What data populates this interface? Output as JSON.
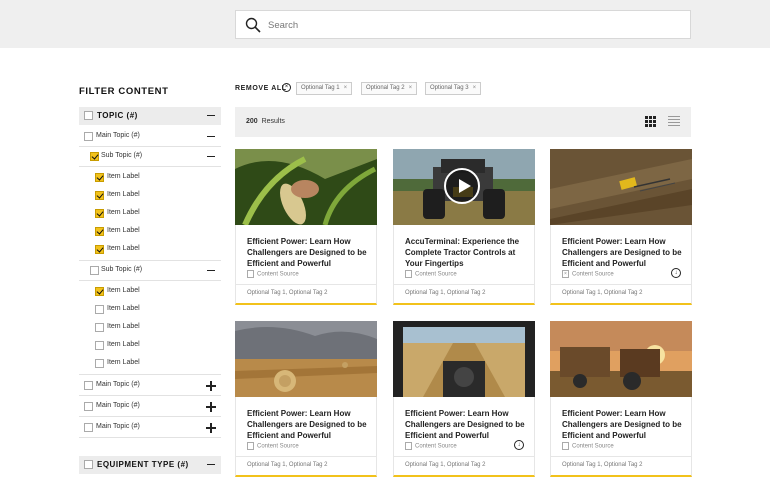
{
  "search": {
    "placeholder": "Search"
  },
  "sidebar": {
    "title": "FILTER CONTENT",
    "topic_section": {
      "label": "TOPIC (#)"
    },
    "main_topic_1": "Main Topic (#)",
    "sub_topic_1": "Sub Topic (#)",
    "sub_topic_1_items": [
      "Item Label",
      "Item Label",
      "Item Label",
      "Item Label",
      "Item Label"
    ],
    "sub_topic_2": "Sub Topic (#)",
    "sub_topic_2_items": [
      "Item Label",
      "Item Label",
      "Item Label",
      "Item Label",
      "Item Label"
    ],
    "main_topic_2": "Main Topic (#)",
    "main_topic_3": "Main Topic (#)",
    "main_topic_4": "Main Topic (#)",
    "equipment_section": {
      "label": "EQUIPMENT TYPE (#)"
    }
  },
  "tag_bar": {
    "remove_all": "REMOVE ALL",
    "tags": [
      "Optional Tag 1",
      "Optional Tag 2",
      "Optional Tag 3"
    ]
  },
  "results": {
    "count": "200",
    "label": "Results"
  },
  "cards": [
    {
      "title": "Efficient Power: Learn How Challengers are Designed to be Efficient and Powerful",
      "source": "Content Source",
      "tags": "Optional Tag 1, Optional Tag 2"
    },
    {
      "title": "AccuTerminal: Experience the Complete Tractor Controls at Your Fingertips",
      "source": "Content Source",
      "tags": "Optional Tag 1, Optional Tag 2"
    },
    {
      "title": "Efficient Power: Learn How Challengers are Designed to be Efficient and Powerful",
      "source": "Content Source",
      "tags": "Optional Tag 1, Optional Tag 2"
    },
    {
      "title": "Efficient Power: Learn How Challengers are Designed to be Efficient and Powerful",
      "source": "Content Source",
      "tags": "Optional Tag 1, Optional Tag 2"
    },
    {
      "title": "Efficient Power: Learn How Challengers are Designed to be Efficient and Powerful",
      "source": "Content Source",
      "tags": "Optional Tag 1, Optional Tag 2"
    },
    {
      "title": "Efficient Power: Learn How Challengers are Designed to be Efficient and Powerful",
      "source": "Content Source",
      "tags": "Optional Tag 1, Optional Tag 2"
    }
  ],
  "colors": {
    "accent": "#f2c21b",
    "panel": "#efefef"
  }
}
